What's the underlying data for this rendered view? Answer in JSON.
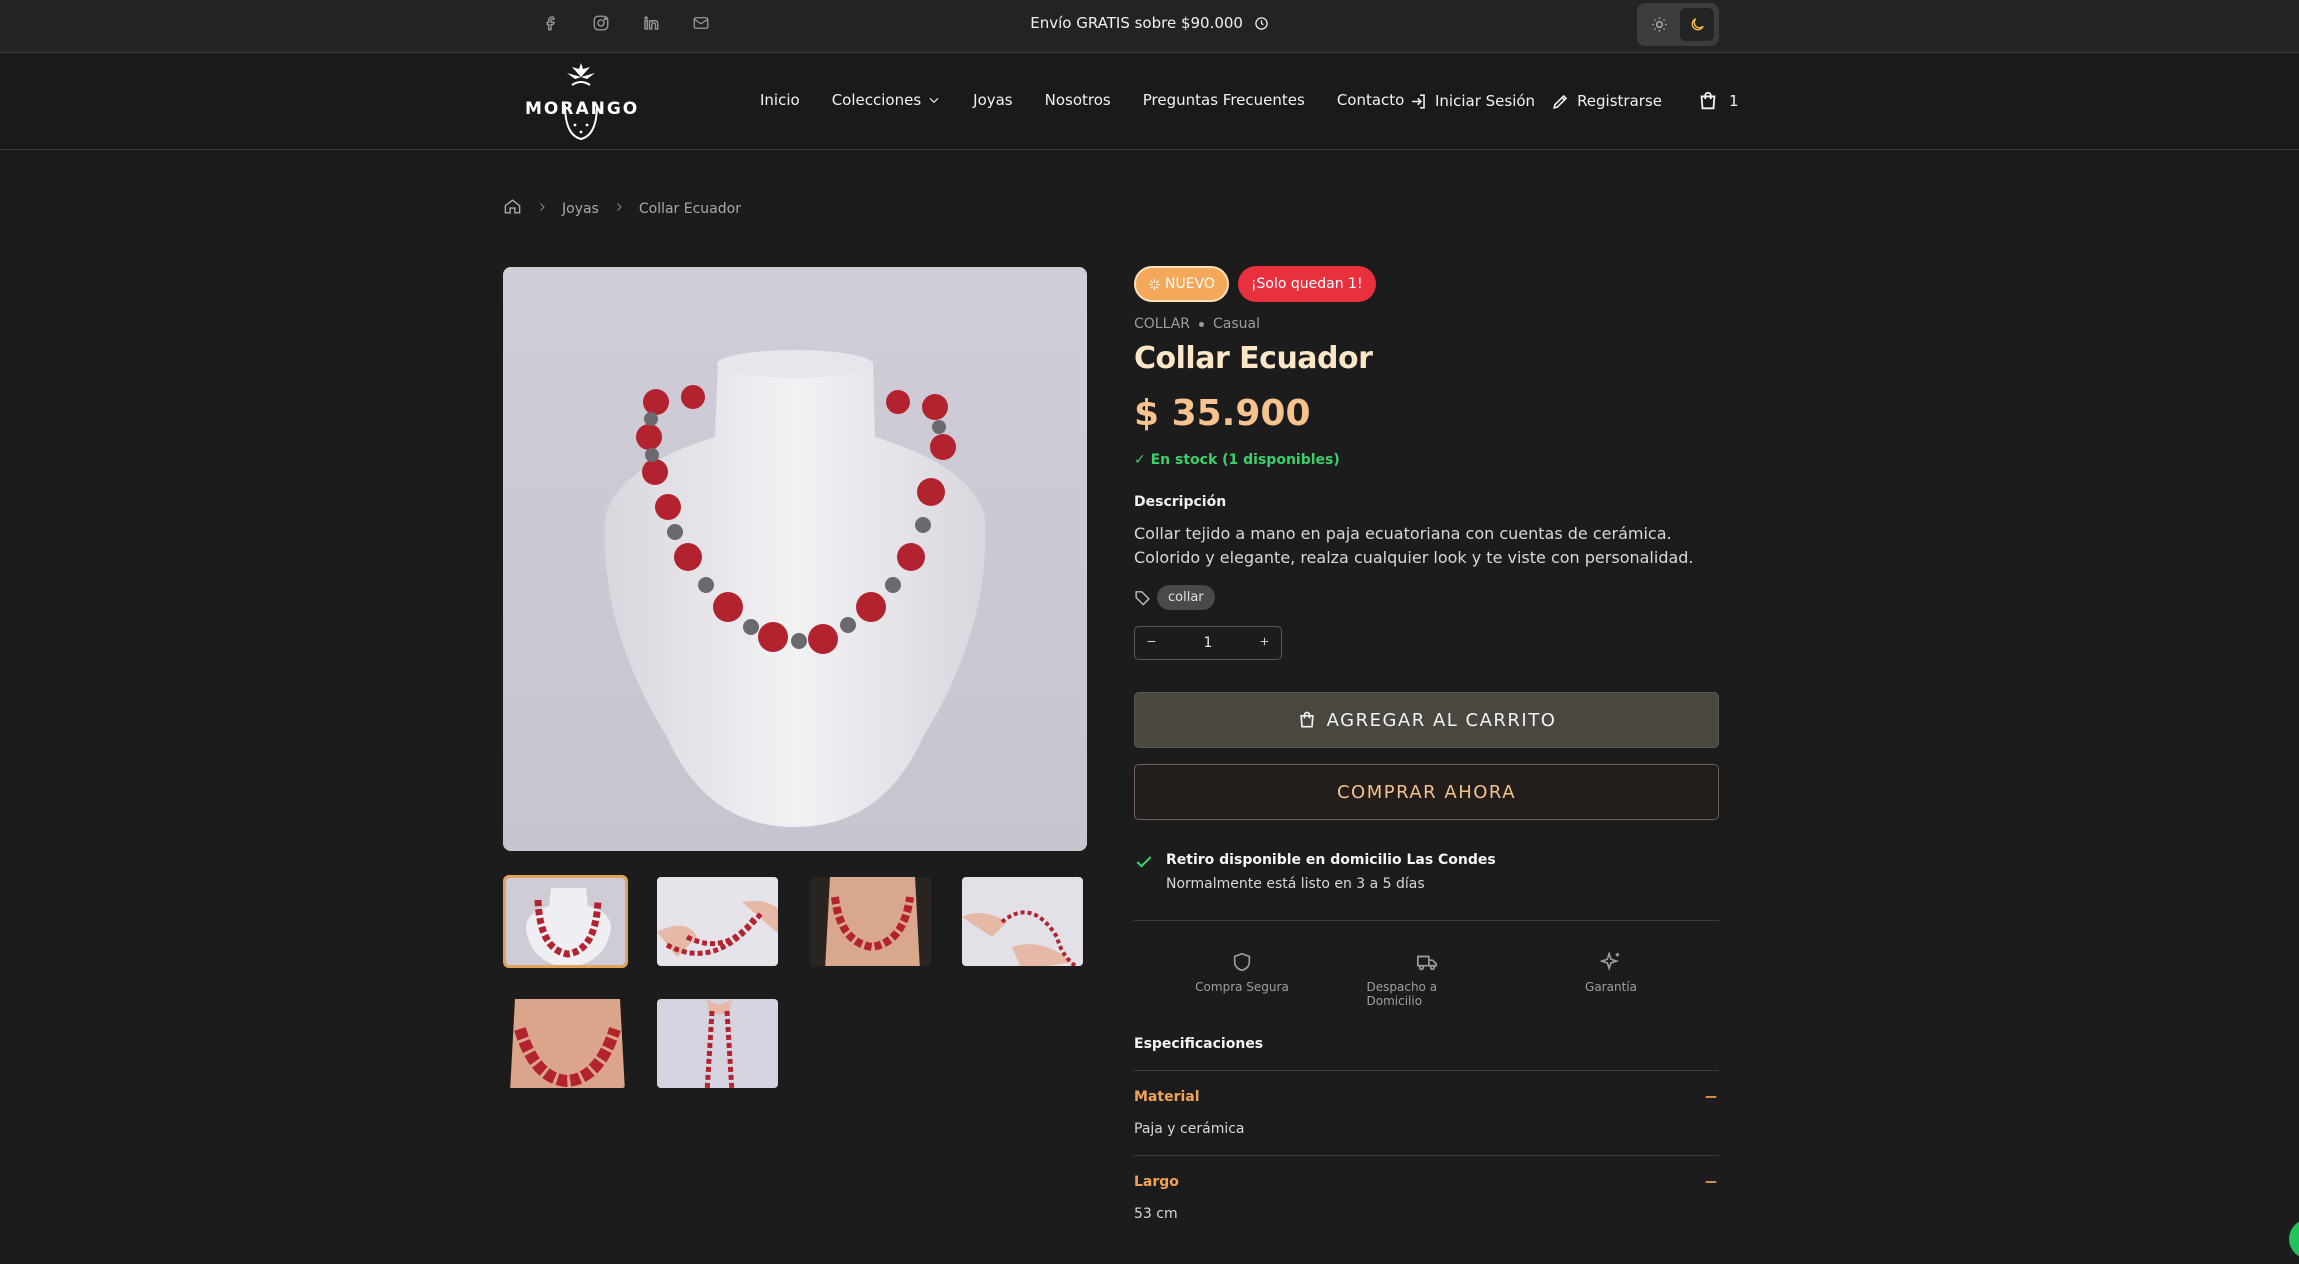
{
  "topbar": {
    "promo_text": "Envío GRATIS sobre $90.000",
    "social_icons": [
      "facebook-icon",
      "instagram-icon",
      "linkedin-icon",
      "mail-icon"
    ],
    "theme": {
      "light_icon": "sun-icon",
      "dark_icon": "moon-icon",
      "active": "dark"
    }
  },
  "header": {
    "logo_text": "MORANGO",
    "nav": [
      "Inicio",
      "Colecciones",
      "Joyas",
      "Nosotros",
      "Preguntas Frecuentes",
      "Contacto"
    ],
    "login_label": "Iniciar Sesión",
    "register_label": "Registrarse",
    "cart_count": "1"
  },
  "breadcrumb": {
    "items": [
      "Joyas",
      "Collar Ecuador"
    ]
  },
  "product": {
    "badge_new": "NUEVO",
    "badge_stock": "¡Solo quedan 1!",
    "category": "COLLAR",
    "style": "Casual",
    "title": "Collar Ecuador",
    "price": "$ 35.900",
    "stock_text": "✓ En stock (1 disponibles)",
    "description_label": "Descripción",
    "description": "Collar tejido a mano en paja ecuatoriana con cuentas de cerámica. Colorido y elegante, realza cualquier look y te viste con personalidad.",
    "tags": [
      "collar"
    ],
    "quantity": "1",
    "add_to_cart_label": "AGREGAR AL CARRITO",
    "buy_now_label": "COMPRAR AHORA",
    "pickup_title": "Retiro disponible en domicilio Las Condes",
    "pickup_sub": "Normalmente está listo en 3 a 5 días",
    "features": [
      "Compra Segura",
      "Despacho a Domicilio",
      "Garantía"
    ],
    "specs_title": "Especificaciones",
    "specs": [
      {
        "name": "Material",
        "value": "Paja y cerámica"
      },
      {
        "name": "Largo",
        "value": "53 cm"
      }
    ]
  },
  "colors": {
    "accent": "#f6c28e",
    "badge_new": "#f3a85a",
    "badge_stock": "#e8303f",
    "in_stock": "#3bd06b",
    "background": "#1c1c1c"
  }
}
